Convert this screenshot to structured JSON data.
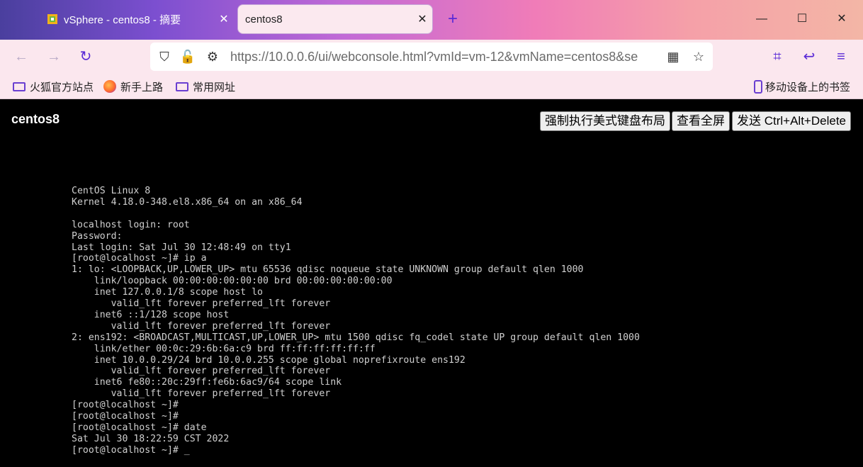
{
  "browser": {
    "tabs": [
      {
        "title": "vSphere - centos8 - 摘要",
        "active": false
      },
      {
        "title": "centos8",
        "active": true
      }
    ],
    "url": "https://10.0.0.6/ui/webconsole.html?vmId=vm-12&vmName=centos8&se",
    "bookmarks": [
      "火狐官方站点",
      "新手上路",
      "常用网址"
    ],
    "mobile_bookmarks": "移动设备上的书签",
    "accent_color": "#5a2ad6"
  },
  "console": {
    "vm_name": "centos8",
    "buttons": {
      "force_us_keyboard": "强制执行美式键盘布局",
      "fullscreen": "查看全屏",
      "send_cad": "发送 Ctrl+Alt+Delete"
    },
    "lines": [
      "CentOS Linux 8",
      "Kernel 4.18.0-348.el8.x86_64 on an x86_64",
      "",
      "localhost login: root",
      "Password:",
      "Last login: Sat Jul 30 12:48:49 on tty1",
      "[root@localhost ~]# ip a",
      "1: lo: <LOOPBACK,UP,LOWER_UP> mtu 65536 qdisc noqueue state UNKNOWN group default qlen 1000",
      "    link/loopback 00:00:00:00:00:00 brd 00:00:00:00:00:00",
      "    inet 127.0.0.1/8 scope host lo",
      "       valid_lft forever preferred_lft forever",
      "    inet6 ::1/128 scope host",
      "       valid_lft forever preferred_lft forever",
      "2: ens192: <BROADCAST,MULTICAST,UP,LOWER_UP> mtu 1500 qdisc fq_codel state UP group default qlen 1000",
      "    link/ether 00:0c:29:6b:6a:c9 brd ff:ff:ff:ff:ff:ff",
      "    inet 10.0.0.29/24 brd 10.0.0.255 scope global noprefixroute ens192",
      "       valid_lft forever preferred_lft forever",
      "    inet6 fe80::20c:29ff:fe6b:6ac9/64 scope link",
      "       valid_lft forever preferred_lft forever",
      "[root@localhost ~]#",
      "[root@localhost ~]#",
      "[root@localhost ~]# date",
      "Sat Jul 30 18:22:59 CST 2022",
      "[root@localhost ~]# _"
    ]
  }
}
